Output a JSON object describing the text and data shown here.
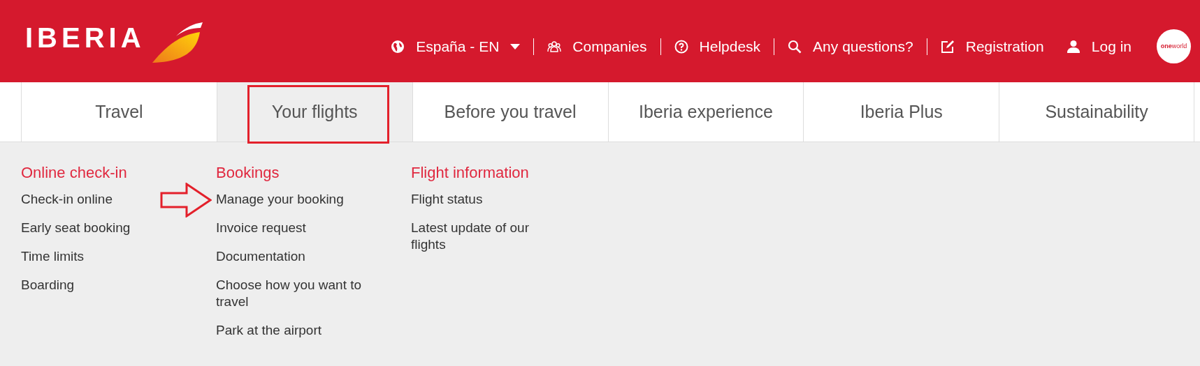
{
  "logo": {
    "text": "IBERIA"
  },
  "top_nav": [
    {
      "kind": "language",
      "label": "España - EN"
    },
    {
      "kind": "companies",
      "label": "Companies"
    },
    {
      "kind": "help",
      "label": "Helpdesk"
    },
    {
      "kind": "search",
      "label": "Any questions?"
    },
    {
      "kind": "register",
      "label": "Registration"
    },
    {
      "kind": "login",
      "label": "Log in"
    }
  ],
  "alliance_badge": {
    "part_1": "one",
    "part_2": "world"
  },
  "tabs": [
    {
      "label": "Travel",
      "selected": false,
      "outlined": false
    },
    {
      "label": "Your flights",
      "selected": true,
      "outlined": true
    },
    {
      "label": "Before you travel",
      "selected": false,
      "outlined": false
    },
    {
      "label": "Iberia experience",
      "selected": false,
      "outlined": false
    },
    {
      "label": "Iberia Plus",
      "selected": false,
      "outlined": false
    },
    {
      "label": "Sustainability",
      "selected": false,
      "outlined": false
    }
  ],
  "menu_columns": [
    {
      "heading": "Online check-in",
      "items": [
        {
          "label": "Check-in online",
          "pointed_at": false
        },
        {
          "label": "Early seat booking",
          "pointed_at": false
        },
        {
          "label": "Time limits",
          "pointed_at": false
        },
        {
          "label": "Boarding",
          "pointed_at": false
        }
      ]
    },
    {
      "heading": "Bookings",
      "items": [
        {
          "label": "Manage your booking",
          "pointed_at": true
        },
        {
          "label": "Invoice request",
          "pointed_at": false
        },
        {
          "label": "Documentation",
          "pointed_at": false
        },
        {
          "label": "Choose how you want to travel",
          "pointed_at": false
        },
        {
          "label": "Park at the airport",
          "pointed_at": false
        }
      ]
    },
    {
      "heading": "Flight information",
      "items": [
        {
          "label": "Flight status",
          "pointed_at": false
        },
        {
          "label": "Latest update of our flights",
          "pointed_at": false
        }
      ]
    }
  ]
}
